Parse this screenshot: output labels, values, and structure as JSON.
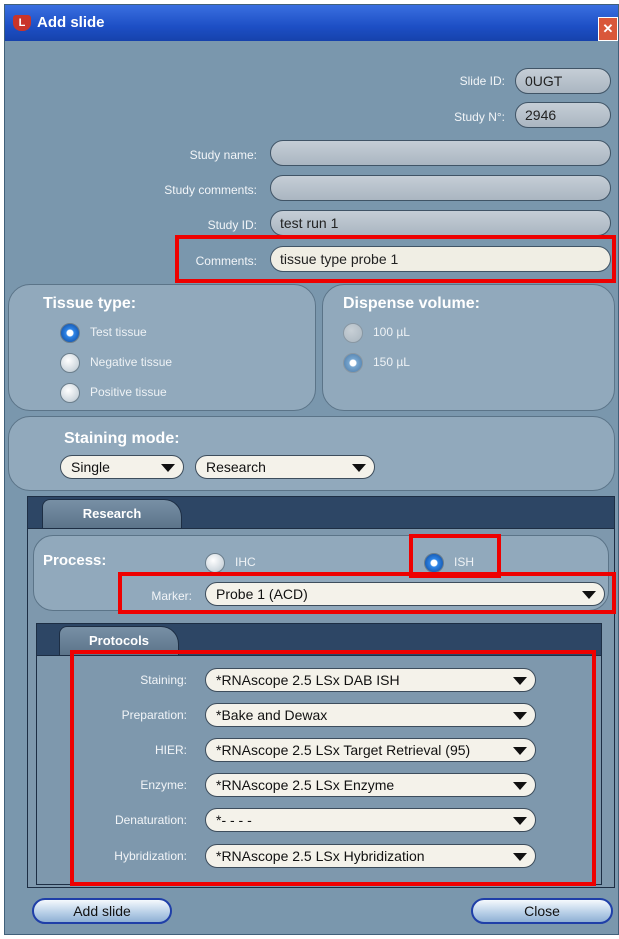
{
  "window": {
    "title": "Add slide",
    "close_glyph": "✕"
  },
  "slide_id": {
    "label": "Slide ID:",
    "value": "0UGT"
  },
  "study_no": {
    "label": "Study N°:",
    "value": "2946"
  },
  "study_name": {
    "label": "Study name:",
    "value": ""
  },
  "study_comments": {
    "label": "Study comments:",
    "value": ""
  },
  "study_id": {
    "label": "Study ID:",
    "value": "test run 1"
  },
  "comments": {
    "label": "Comments:",
    "value": "tissue type probe 1"
  },
  "tissue_type": {
    "title": "Tissue type:",
    "options": [
      "Test tissue",
      "Negative tissue",
      "Positive tissue"
    ],
    "selected": "Test tissue"
  },
  "dispense_volume": {
    "title": "Dispense volume:",
    "options": [
      "100 µL",
      "150 µL"
    ],
    "selected": "150 µL"
  },
  "staining_mode": {
    "title": "Staining mode:",
    "mode": "Single",
    "type": "Research"
  },
  "research_tab": {
    "tab_label": "Research",
    "process_label": "Process:",
    "ihc_label": "IHC",
    "ish_label": "ISH",
    "selected": "ISH",
    "marker_label": "Marker:",
    "marker_value": "Probe 1  (ACD)"
  },
  "protocols_tab": {
    "tab_label": "Protocols",
    "rows": [
      {
        "label": "Staining:",
        "value": "*RNAscope 2.5 LSx DAB ISH"
      },
      {
        "label": "Preparation:",
        "value": "*Bake and Dewax"
      },
      {
        "label": "HIER:",
        "value": "*RNAscope 2.5 LSx Target Retrieval (95)"
      },
      {
        "label": "Enzyme:",
        "value": "*RNAscope 2.5 LSx Enzyme"
      },
      {
        "label": "Denaturation:",
        "value": "*- - - -"
      },
      {
        "label": "Hybridization:",
        "value": "*RNAscope 2.5 LSx Hybridization"
      }
    ]
  },
  "footer": {
    "add_label": "Add slide",
    "close_label": "Close"
  },
  "colors": {
    "highlight": "#ee0000",
    "window_bg": "#7a97ad",
    "titlebar": "#1d4fc5"
  }
}
